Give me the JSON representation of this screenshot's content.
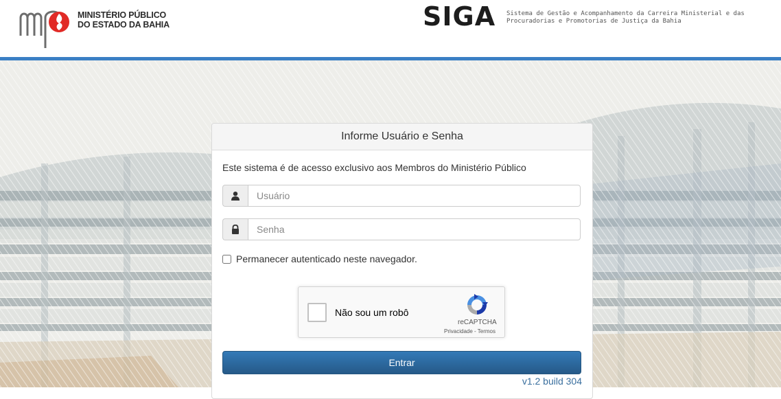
{
  "header": {
    "org_line1": "MINISTÉRIO PÚBLICO",
    "org_line2": "DO ESTADO DA BAHIA",
    "system_name": "SIGA",
    "system_desc_line1": "Sistema de Gestão e Acompanhamento da Carreira Ministerial e das",
    "system_desc_line2": "Procuradorias e Promotorias de Justiça da Bahia",
    "accent_color": "#3a7fc4"
  },
  "login": {
    "heading": "Informe Usuário e Senha",
    "notice": "Este sistema é de acesso exclusivo aos Membros do Ministério Público",
    "user_icon": "user-icon",
    "user_placeholder": "Usuário",
    "user_value": "",
    "pass_icon": "lock-icon",
    "pass_placeholder": "Senha",
    "pass_value": "",
    "remember_label": "Permanecer autenticado neste navegador.",
    "remember_checked": false,
    "submit_label": "Entrar",
    "version": "v1.2 build 304",
    "primary_color": "#337ab7"
  },
  "recaptcha": {
    "label": "Não sou um robô",
    "brand": "reCAPTCHA",
    "privacy": "Privacidade",
    "separator": " - ",
    "terms": "Termos"
  }
}
